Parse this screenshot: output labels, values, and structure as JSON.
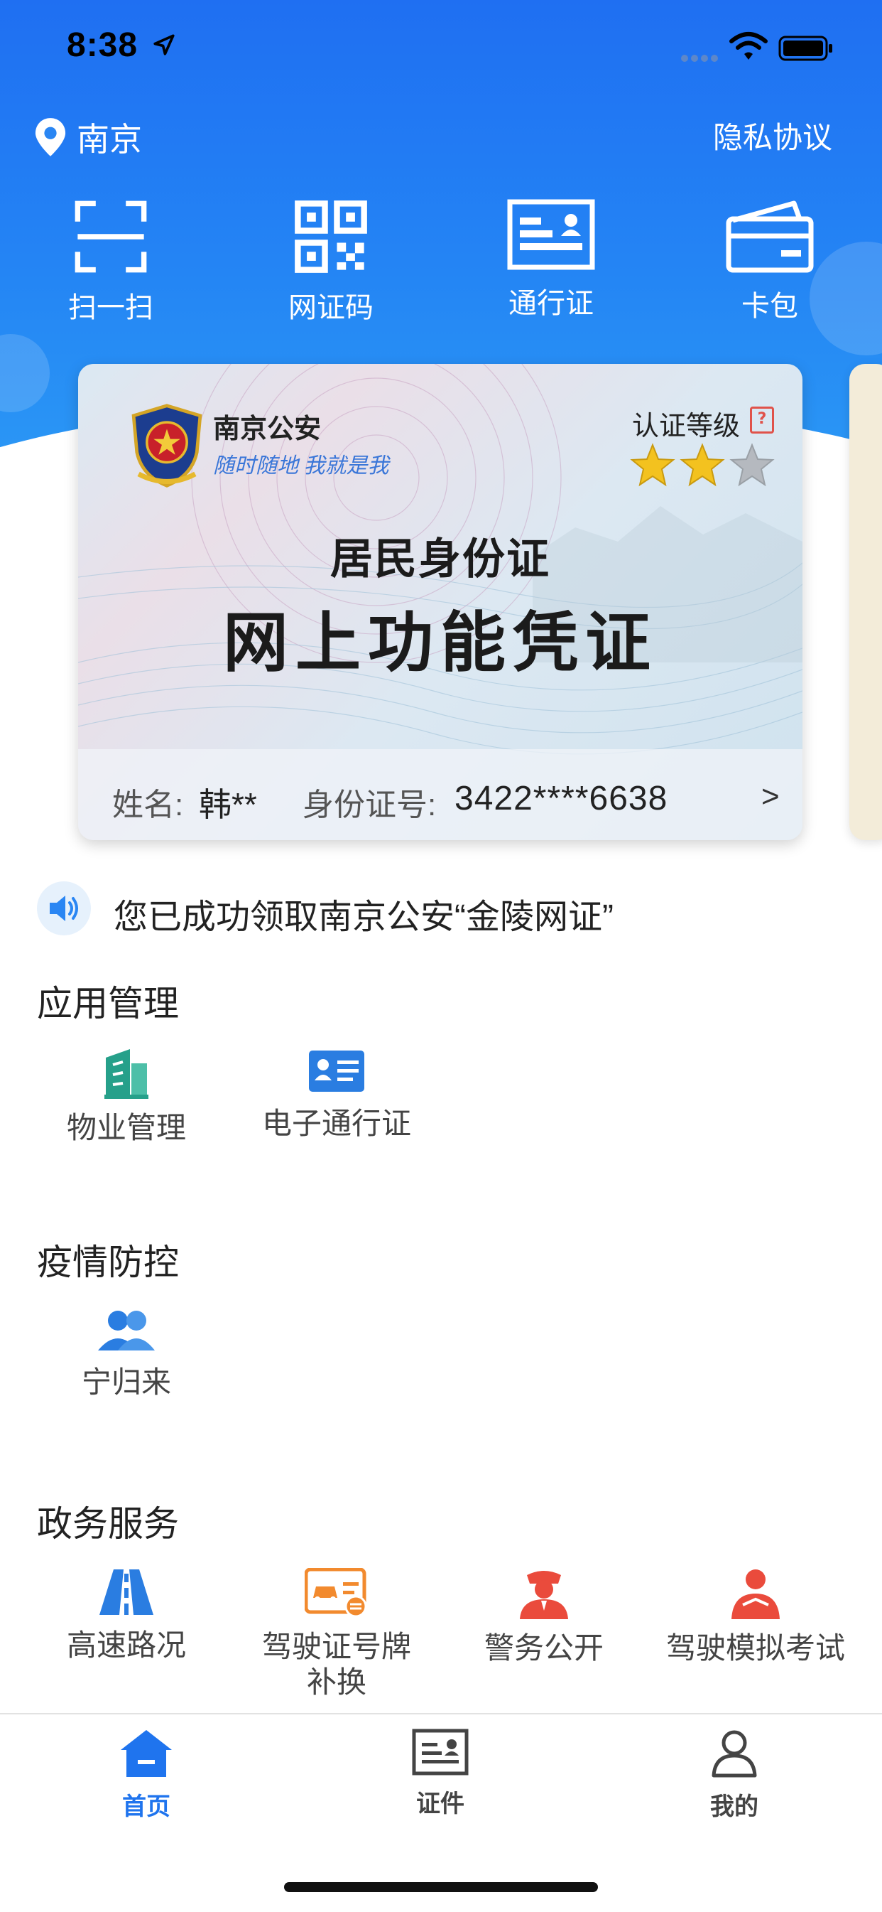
{
  "status_bar": {
    "time": "8:38"
  },
  "header": {
    "city": "南京",
    "privacy_label": "隐私协议",
    "quick_actions": [
      {
        "label": "扫一扫",
        "icon": "scan-icon"
      },
      {
        "label": "网证码",
        "icon": "qr-code-icon"
      },
      {
        "label": "通行证",
        "icon": "pass-card-icon"
      },
      {
        "label": "卡包",
        "icon": "wallet-icon"
      }
    ]
  },
  "card": {
    "agency": "南京公安",
    "slogan": "随时随地 我就是我",
    "level_label": "认证等级",
    "level_hint": "?",
    "stars_filled": 2,
    "stars_total": 3,
    "title_line1": "居民身份证",
    "title_line2": "网上功能凭证",
    "name_label": "姓名:",
    "name_value": "韩**",
    "id_label": "身份证号:",
    "id_value": "3422****6638",
    "arrow": ">"
  },
  "notice": {
    "text": "您已成功领取南京公安“金陵网证”"
  },
  "sections": {
    "app_management": {
      "title": "应用管理",
      "items": [
        {
          "label": "物业管理",
          "icon": "building-icon"
        },
        {
          "label": "电子通行证",
          "icon": "e-pass-icon"
        }
      ]
    },
    "epidemic": {
      "title": "疫情防控",
      "items": [
        {
          "label": "宁归来",
          "icon": "people-icon"
        }
      ]
    },
    "gov_services": {
      "title": "政务服务",
      "items": [
        {
          "label": "高速路况",
          "icon": "highway-icon"
        },
        {
          "label": "驾驶证号牌",
          "label2": "补换",
          "icon": "license-icon"
        },
        {
          "label": "警务公开",
          "icon": "police-icon"
        },
        {
          "label": "驾驶模拟考试",
          "icon": "driver-exam-icon"
        }
      ]
    }
  },
  "tabbar": {
    "tabs": [
      {
        "label": "首页",
        "active": true
      },
      {
        "label": "证件",
        "active": false
      },
      {
        "label": "我的",
        "active": false
      }
    ],
    "active_color": "#1f74ee",
    "inactive_color": "#444444"
  },
  "colors": {
    "header_blue": "#1f6ff2",
    "service_orange": "#f28a2e",
    "service_red": "#ea4b3c",
    "service_blue": "#2a7de1",
    "app_teal": "#26a08a"
  }
}
